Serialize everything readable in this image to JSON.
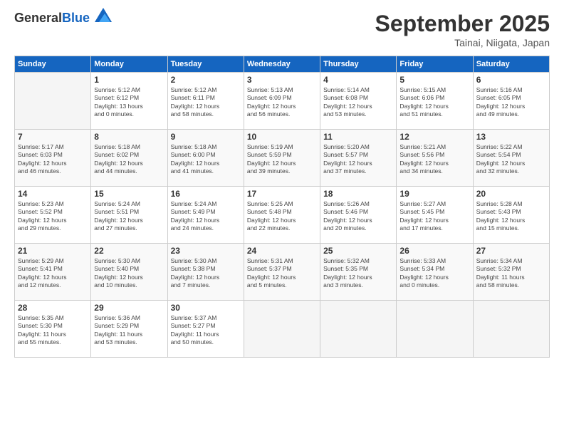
{
  "logo": {
    "general": "General",
    "blue": "Blue"
  },
  "header": {
    "month": "September 2025",
    "location": "Tainai, Niigata, Japan"
  },
  "weekdays": [
    "Sunday",
    "Monday",
    "Tuesday",
    "Wednesday",
    "Thursday",
    "Friday",
    "Saturday"
  ],
  "weeks": [
    [
      {
        "day": "",
        "info": ""
      },
      {
        "day": "1",
        "info": "Sunrise: 5:12 AM\nSunset: 6:12 PM\nDaylight: 13 hours\nand 0 minutes."
      },
      {
        "day": "2",
        "info": "Sunrise: 5:12 AM\nSunset: 6:11 PM\nDaylight: 12 hours\nand 58 minutes."
      },
      {
        "day": "3",
        "info": "Sunrise: 5:13 AM\nSunset: 6:09 PM\nDaylight: 12 hours\nand 56 minutes."
      },
      {
        "day": "4",
        "info": "Sunrise: 5:14 AM\nSunset: 6:08 PM\nDaylight: 12 hours\nand 53 minutes."
      },
      {
        "day": "5",
        "info": "Sunrise: 5:15 AM\nSunset: 6:06 PM\nDaylight: 12 hours\nand 51 minutes."
      },
      {
        "day": "6",
        "info": "Sunrise: 5:16 AM\nSunset: 6:05 PM\nDaylight: 12 hours\nand 49 minutes."
      }
    ],
    [
      {
        "day": "7",
        "info": "Sunrise: 5:17 AM\nSunset: 6:03 PM\nDaylight: 12 hours\nand 46 minutes."
      },
      {
        "day": "8",
        "info": "Sunrise: 5:18 AM\nSunset: 6:02 PM\nDaylight: 12 hours\nand 44 minutes."
      },
      {
        "day": "9",
        "info": "Sunrise: 5:18 AM\nSunset: 6:00 PM\nDaylight: 12 hours\nand 41 minutes."
      },
      {
        "day": "10",
        "info": "Sunrise: 5:19 AM\nSunset: 5:59 PM\nDaylight: 12 hours\nand 39 minutes."
      },
      {
        "day": "11",
        "info": "Sunrise: 5:20 AM\nSunset: 5:57 PM\nDaylight: 12 hours\nand 37 minutes."
      },
      {
        "day": "12",
        "info": "Sunrise: 5:21 AM\nSunset: 5:56 PM\nDaylight: 12 hours\nand 34 minutes."
      },
      {
        "day": "13",
        "info": "Sunrise: 5:22 AM\nSunset: 5:54 PM\nDaylight: 12 hours\nand 32 minutes."
      }
    ],
    [
      {
        "day": "14",
        "info": "Sunrise: 5:23 AM\nSunset: 5:52 PM\nDaylight: 12 hours\nand 29 minutes."
      },
      {
        "day": "15",
        "info": "Sunrise: 5:24 AM\nSunset: 5:51 PM\nDaylight: 12 hours\nand 27 minutes."
      },
      {
        "day": "16",
        "info": "Sunrise: 5:24 AM\nSunset: 5:49 PM\nDaylight: 12 hours\nand 24 minutes."
      },
      {
        "day": "17",
        "info": "Sunrise: 5:25 AM\nSunset: 5:48 PM\nDaylight: 12 hours\nand 22 minutes."
      },
      {
        "day": "18",
        "info": "Sunrise: 5:26 AM\nSunset: 5:46 PM\nDaylight: 12 hours\nand 20 minutes."
      },
      {
        "day": "19",
        "info": "Sunrise: 5:27 AM\nSunset: 5:45 PM\nDaylight: 12 hours\nand 17 minutes."
      },
      {
        "day": "20",
        "info": "Sunrise: 5:28 AM\nSunset: 5:43 PM\nDaylight: 12 hours\nand 15 minutes."
      }
    ],
    [
      {
        "day": "21",
        "info": "Sunrise: 5:29 AM\nSunset: 5:41 PM\nDaylight: 12 hours\nand 12 minutes."
      },
      {
        "day": "22",
        "info": "Sunrise: 5:30 AM\nSunset: 5:40 PM\nDaylight: 12 hours\nand 10 minutes."
      },
      {
        "day": "23",
        "info": "Sunrise: 5:30 AM\nSunset: 5:38 PM\nDaylight: 12 hours\nand 7 minutes."
      },
      {
        "day": "24",
        "info": "Sunrise: 5:31 AM\nSunset: 5:37 PM\nDaylight: 12 hours\nand 5 minutes."
      },
      {
        "day": "25",
        "info": "Sunrise: 5:32 AM\nSunset: 5:35 PM\nDaylight: 12 hours\nand 3 minutes."
      },
      {
        "day": "26",
        "info": "Sunrise: 5:33 AM\nSunset: 5:34 PM\nDaylight: 12 hours\nand 0 minutes."
      },
      {
        "day": "27",
        "info": "Sunrise: 5:34 AM\nSunset: 5:32 PM\nDaylight: 11 hours\nand 58 minutes."
      }
    ],
    [
      {
        "day": "28",
        "info": "Sunrise: 5:35 AM\nSunset: 5:30 PM\nDaylight: 11 hours\nand 55 minutes."
      },
      {
        "day": "29",
        "info": "Sunrise: 5:36 AM\nSunset: 5:29 PM\nDaylight: 11 hours\nand 53 minutes."
      },
      {
        "day": "30",
        "info": "Sunrise: 5:37 AM\nSunset: 5:27 PM\nDaylight: 11 hours\nand 50 minutes."
      },
      {
        "day": "",
        "info": ""
      },
      {
        "day": "",
        "info": ""
      },
      {
        "day": "",
        "info": ""
      },
      {
        "day": "",
        "info": ""
      }
    ]
  ]
}
